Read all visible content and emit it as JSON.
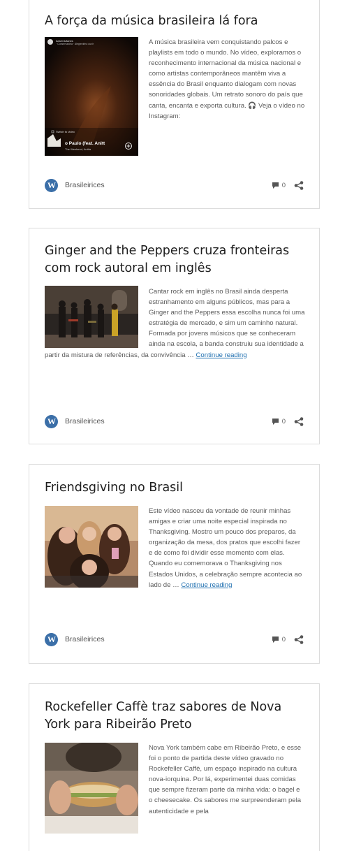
{
  "posts": [
    {
      "title": "A força da música brasileira lá fora",
      "excerpt": "A música brasileira vem conquistando palcos e playlists em todo o mundo. No vídeo, exploramos o reconhecimento internacional da música nacional e como artistas contemporâneos mantêm viva a essência do Brasil enquanto dialogam com novas sonoridades globais. Um retrato sonoro do país que canta, encanta e exporta cultura. 🎧 Veja o vídeo no Instagram:",
      "continue_label": "",
      "thumb_overlay": {
        "account": "israel.tiufanes",
        "account_sub": "· Conservatória · Alegrezinho ouvir",
        "switch_label": "Switch to video",
        "song": "o Paulo (feat. Anitt",
        "artist": "The Weekend, Anitta"
      },
      "author": "Brasileirices",
      "comments": "0"
    },
    {
      "title": "Ginger and the Peppers cruza fronteiras com rock autoral em inglês",
      "excerpt": "Cantar rock em inglês no Brasil ainda desperta estranhamento em alguns públicos, mas para a Ginger and the Peppers essa escolha nunca foi uma estratégia de mercado, e sim um caminho natural. Formada por jovens músicos que se conheceram ainda na escola, a banda construiu sua identidade a partir da mistura de referências, da convivência …",
      "continue_label": "Continue reading",
      "author": "Brasileirices",
      "comments": "0"
    },
    {
      "title": "Friendsgiving no Brasil",
      "excerpt": "Este vídeo nasceu da vontade de reunir minhas amigas e criar uma noite especial inspirada no Thanksgiving. Mostro um pouco dos preparos, da organização da mesa, dos pratos que escolhi fazer e de como foi dividir esse momento com elas. Quando eu comemorava o Thanksgiving nos Estados Unidos, a celebração sempre acontecia ao lado de …",
      "continue_label": "Continue reading",
      "author": "Brasileirices",
      "comments": "0"
    },
    {
      "title": "Rockefeller Caffè traz sabores de Nova York para Ribeirão Preto",
      "excerpt": "Nova York também cabe em Ribeirão Preto, e esse foi o ponto de partida deste vídeo gravado no Rockefeller Caffè, um espaço inspirado na cultura nova-iorquina. Por lá, experimentei duas comidas que sempre fizeram parte da minha vida: o bagel e o cheesecake. Os sabores me surpreenderam pela autenticidade e pela",
      "continue_label": "",
      "author": "",
      "comments": ""
    }
  ],
  "icons": {
    "author_logo": "wordpress-icon",
    "comments": "comment-bubble-icon",
    "share": "share-icon"
  },
  "colors": {
    "link": "#2271b1",
    "wordpress_blue": "#3b6fa8",
    "card_border": "#dcdcdc"
  }
}
